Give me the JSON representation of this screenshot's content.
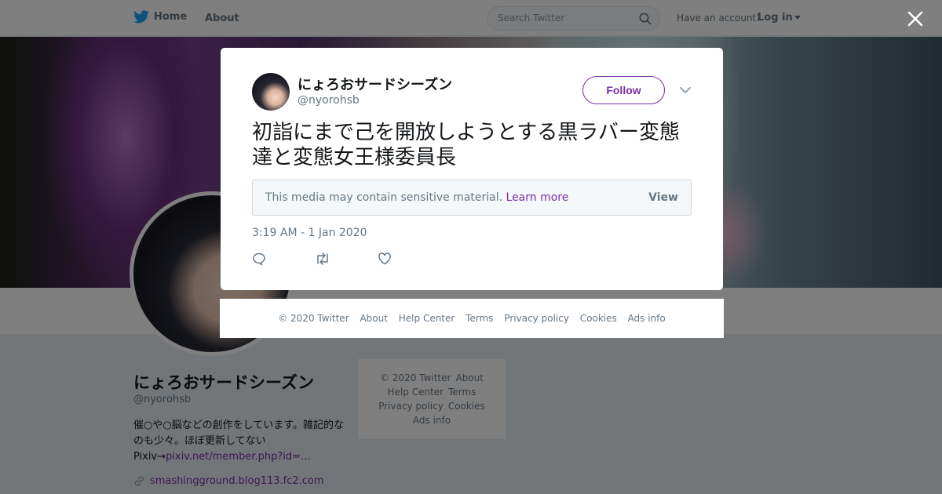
{
  "topnav": {
    "home_label": "Home",
    "about_label": "About",
    "search_placeholder": "Search Twitter",
    "have_account": "Have an account?",
    "login_label": "Log in"
  },
  "profile": {
    "name": "にょろおサードシーズン",
    "handle": "@nyorohsb",
    "bio_line": "催○や○脳などの創作をしています。雑記的なのも少々。ほぼ更新してない",
    "bio_pixiv_prefix": "Pixiv→",
    "bio_pixiv_link": "pixiv.net/member.php?id=…",
    "website": "smashingground.blog113.fc2.com"
  },
  "side_footer": {
    "copyright": "© 2020 Twitter",
    "about": "About",
    "help": "Help Center",
    "terms": "Terms",
    "privacy": "Privacy policy",
    "cookies": "Cookies",
    "ads": "Ads info"
  },
  "modal": {
    "name": "にょろおサードシーズン",
    "handle": "@nyorohsb",
    "follow_label": "Follow",
    "tweet_text": "初詣にまで己を開放しようとする黒ラバー変態達と変態女王様委員長",
    "sensitive_msg": "This media may contain sensitive material.",
    "learn_more": "Learn more",
    "view_label": "View",
    "timestamp": "3:19 AM - 1 Jan 2020"
  },
  "modal_footer": {
    "copyright": "© 2020 Twitter",
    "about": "About",
    "help": "Help Center",
    "terms": "Terms",
    "privacy": "Privacy policy",
    "cookies": "Cookies",
    "ads": "Ads info"
  },
  "colors": {
    "accent": "#7b2ea3",
    "twitter_blue": "#1da1f2"
  }
}
